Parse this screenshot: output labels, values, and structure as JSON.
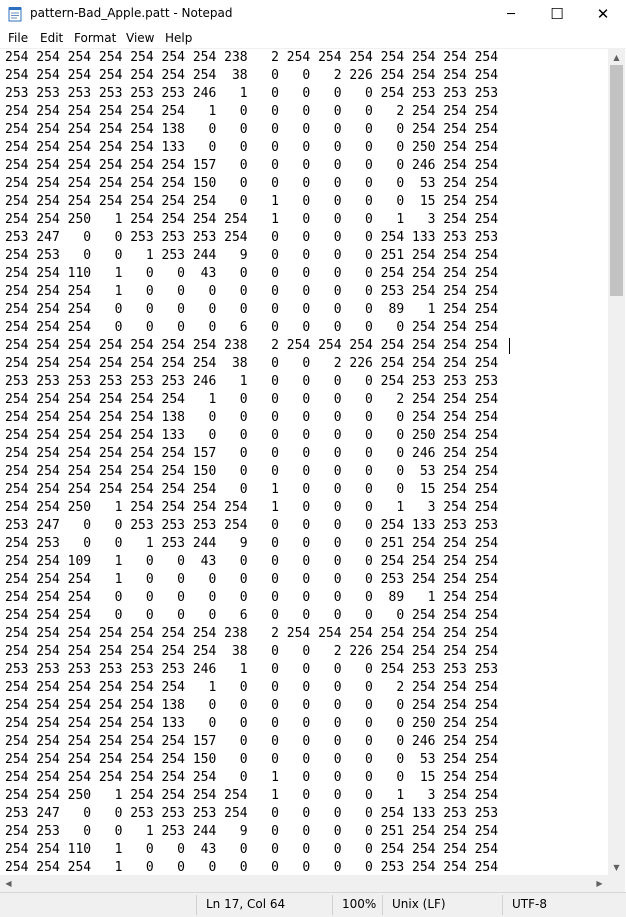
{
  "window": {
    "title": "pattern-Bad_Apple.patt - Notepad",
    "minimize_glyph": "─",
    "maximize_glyph": "☐",
    "close_glyph": "✕"
  },
  "menu": [
    "File",
    "Edit",
    "Format",
    "View",
    "Help"
  ],
  "lines": [
    "254 254 254 254 254 254 254 238   2 254 254 254 254 254 254 254",
    "254 254 254 254 254 254 254  38   0   0   2 226 254 254 254 254",
    "253 253 253 253 253 253 246   1   0   0   0   0 254 253 253 253",
    "254 254 254 254 254 254   1   0   0   0   0   0   2 254 254 254",
    "254 254 254 254 254 138   0   0   0   0   0   0   0 254 254 254",
    "254 254 254 254 254 133   0   0   0   0   0   0   0 250 254 254",
    "254 254 254 254 254 254 157   0   0   0   0   0   0 246 254 254",
    "254 254 254 254 254 254 150   0   0   0   0   0   0  53 254 254",
    "254 254 254 254 254 254 254   0   1   0   0   0   0  15 254 254",
    "254 254 250   1 254 254 254 254   1   0   0   0   1   3 254 254",
    "253 247   0   0 253 253 253 254   0   0   0   0 254 133 253 253",
    "254 253   0   0   1 253 244   9   0   0   0   0 251 254 254 254",
    "254 254 110   1   0   0  43   0   0   0   0   0 254 254 254 254",
    "254 254 254   1   0   0   0   0   0   0   0   0 253 254 254 254",
    "254 254 254   0   0   0   0   0   0   0   0   0  89   1 254 254",
    "254 254 254   0   0   0   0   6   0   0   0   0   0 254 254 254",
    "254 254 254 254 254 254 254 238   2 254 254 254 254 254 254 254",
    "254 254 254 254 254 254 254  38   0   0   2 226 254 254 254 254",
    "253 253 253 253 253 253 246   1   0   0   0   0 254 253 253 253",
    "254 254 254 254 254 254   1   0   0   0   0   0   2 254 254 254",
    "254 254 254 254 254 138   0   0   0   0   0   0   0 254 254 254",
    "254 254 254 254 254 133   0   0   0   0   0   0   0 250 254 254",
    "254 254 254 254 254 254 157   0   0   0   0   0   0 246 254 254",
    "254 254 254 254 254 254 150   0   0   0   0   0   0  53 254 254",
    "254 254 254 254 254 254 254   0   1   0   0   0   0  15 254 254",
    "254 254 250   1 254 254 254 254   1   0   0   0   1   3 254 254",
    "253 247   0   0 253 253 253 254   0   0   0   0 254 133 253 253",
    "254 253   0   0   1 253 244   9   0   0   0   0 251 254 254 254",
    "254 254 109   1   0   0  43   0   0   0   0   0 254 254 254 254",
    "254 254 254   1   0   0   0   0   0   0   0   0 253 254 254 254",
    "254 254 254   0   0   0   0   0   0   0   0   0  89   1 254 254",
    "254 254 254   0   0   0   0   6   0   0   0   0   0 254 254 254",
    "254 254 254 254 254 254 254 238   2 254 254 254 254 254 254 254",
    "254 254 254 254 254 254 254  38   0   0   2 226 254 254 254 254",
    "253 253 253 253 253 253 246   1   0   0   0   0 254 253 253 253",
    "254 254 254 254 254 254   1   0   0   0   0   0   2 254 254 254",
    "254 254 254 254 254 138   0   0   0   0   0   0   0 254 254 254",
    "254 254 254 254 254 133   0   0   0   0   0   0   0 250 254 254",
    "254 254 254 254 254 254 157   0   0   0   0   0   0 246 254 254",
    "254 254 254 254 254 254 150   0   0   0   0   0   0  53 254 254",
    "254 254 254 254 254 254 254   0   1   0   0   0   0  15 254 254",
    "254 254 250   1 254 254 254 254   1   0   0   0   1   3 254 254",
    "253 247   0   0 253 253 253 254   0   0   0   0 254 133 253 253",
    "254 253   0   0   1 253 244   9   0   0   0   0 251 254 254 254",
    "254 254 110   1   0   0  43   0   0   0   0   0 254 254 254 254",
    "254 254 254   1   0   0   0   0   0   0   0   0 253 254 254 254"
  ],
  "status": {
    "position": "Ln 17, Col 64",
    "zoom": "100%",
    "line_ending": "Unix (LF)",
    "encoding": "UTF-8"
  },
  "colors": {
    "chrome": "#f0f0f0",
    "scroll_thumb": "#c2c2c2",
    "icon_blue": "#2b6fc2"
  }
}
